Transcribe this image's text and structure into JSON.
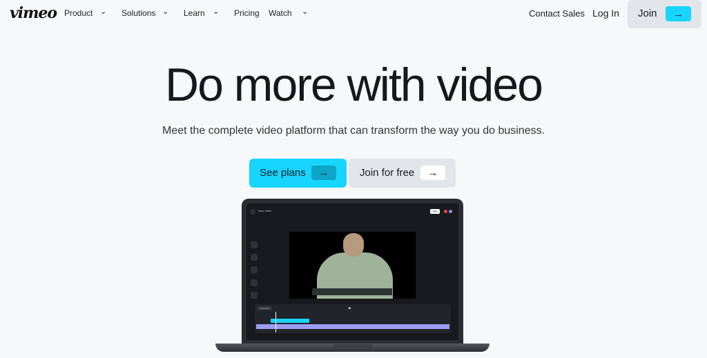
{
  "nav": {
    "logo": "vimeo",
    "items": [
      {
        "label": "Product",
        "dropdown": true
      },
      {
        "label": "Solutions",
        "dropdown": true
      },
      {
        "label": "Learn",
        "dropdown": true
      },
      {
        "label": "Pricing",
        "dropdown": false
      },
      {
        "label": "Watch",
        "dropdown": true
      }
    ],
    "contact_sales": "Contact Sales",
    "log_in": "Log In",
    "join": "Join"
  },
  "hero": {
    "title": "Do more with video",
    "subtitle": "Meet the complete video platform that can transform the way you do business.",
    "primary_cta": "See plans",
    "secondary_cta": "Join for free"
  },
  "editor": {
    "title": "New Video",
    "save": "Save",
    "transcript": "Transcript"
  },
  "colors": {
    "accent": "#17d5ff",
    "background": "#f7f8fa",
    "secondary_button": "#e2e5ea"
  }
}
